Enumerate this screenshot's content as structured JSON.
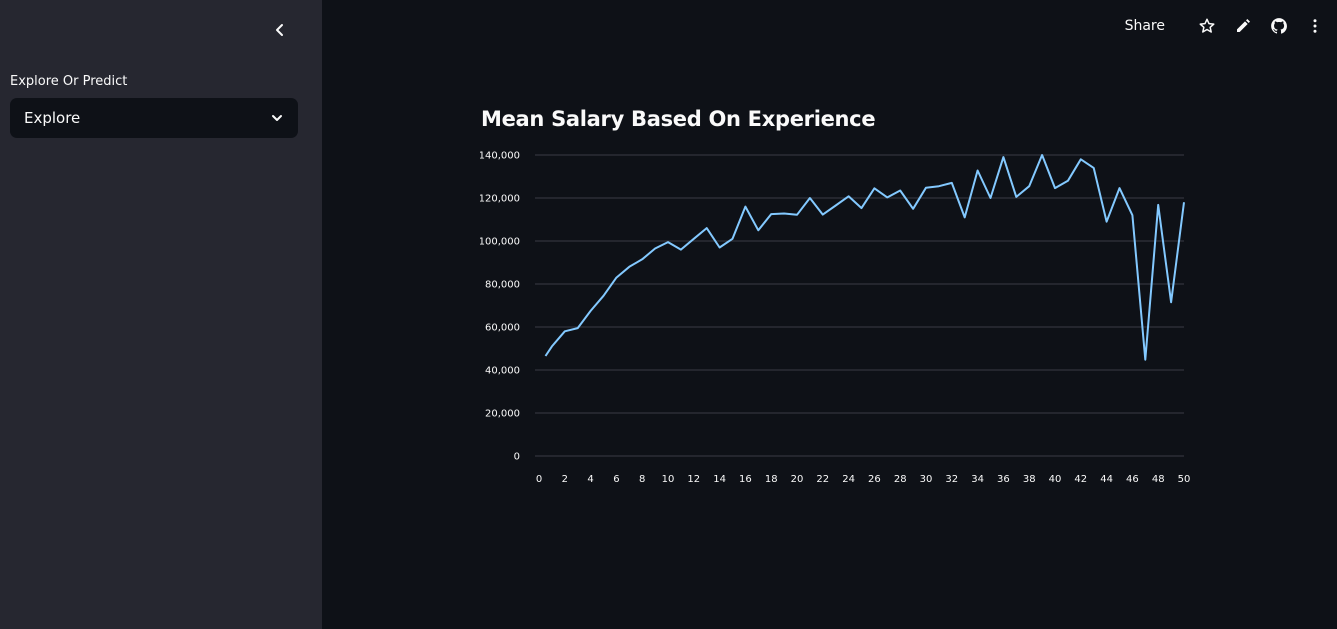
{
  "sidebar": {
    "select_label": "Explore Or Predict",
    "select_value": "Explore",
    "collapse_icon": "chevron-left-icon",
    "dropdown_icon": "chevron-down-icon",
    "background": "#262730"
  },
  "toolbar": {
    "share_label": "Share",
    "icons": [
      "star-icon",
      "edit-icon",
      "github-icon",
      "more-vertical-icon"
    ]
  },
  "chart_data": {
    "type": "line",
    "title": "Mean Salary Based On Experience",
    "xlabel": "",
    "ylabel": "",
    "xlim": [
      0,
      50
    ],
    "ylim": [
      0,
      140000
    ],
    "x_ticks": [
      0,
      2,
      4,
      6,
      8,
      10,
      12,
      14,
      16,
      18,
      20,
      22,
      24,
      26,
      28,
      30,
      32,
      34,
      36,
      38,
      40,
      42,
      44,
      46,
      48,
      50
    ],
    "y_ticks": [
      0,
      20000,
      40000,
      60000,
      80000,
      100000,
      120000,
      140000
    ],
    "y_tick_labels": [
      "0",
      "20,000",
      "40,000",
      "60,000",
      "80,000",
      "100,000",
      "120,000",
      "140,000"
    ],
    "grid": true,
    "line_color": "#83c9ff",
    "series": [
      {
        "x": [
          0.5,
          1,
          2,
          3,
          4,
          5,
          6,
          7,
          8,
          9,
          10,
          11,
          12,
          13,
          14,
          15,
          16,
          17,
          18,
          19,
          20,
          21,
          22,
          23,
          24,
          25,
          26,
          27,
          28,
          29,
          30,
          31,
          32,
          33,
          34,
          35,
          36,
          37,
          38,
          39,
          40,
          41,
          42,
          43,
          44,
          45,
          46,
          47,
          48,
          49,
          50
        ],
        "values": [
          46500,
          51000,
          58000,
          59500,
          67500,
          74500,
          83000,
          88000,
          91500,
          96500,
          99500,
          96000,
          101000,
          106000,
          97000,
          101000,
          116000,
          105000,
          112500,
          112800,
          112200,
          120000,
          112300,
          116500,
          120800,
          115300,
          124500,
          120300,
          123500,
          115000,
          124800,
          125500,
          127000,
          111000,
          132800,
          120000,
          139000,
          120500,
          125500,
          140000,
          124600,
          128000,
          138000,
          134000,
          109000,
          124600,
          112000,
          44800,
          116800,
          71500,
          118000
        ]
      }
    ]
  }
}
